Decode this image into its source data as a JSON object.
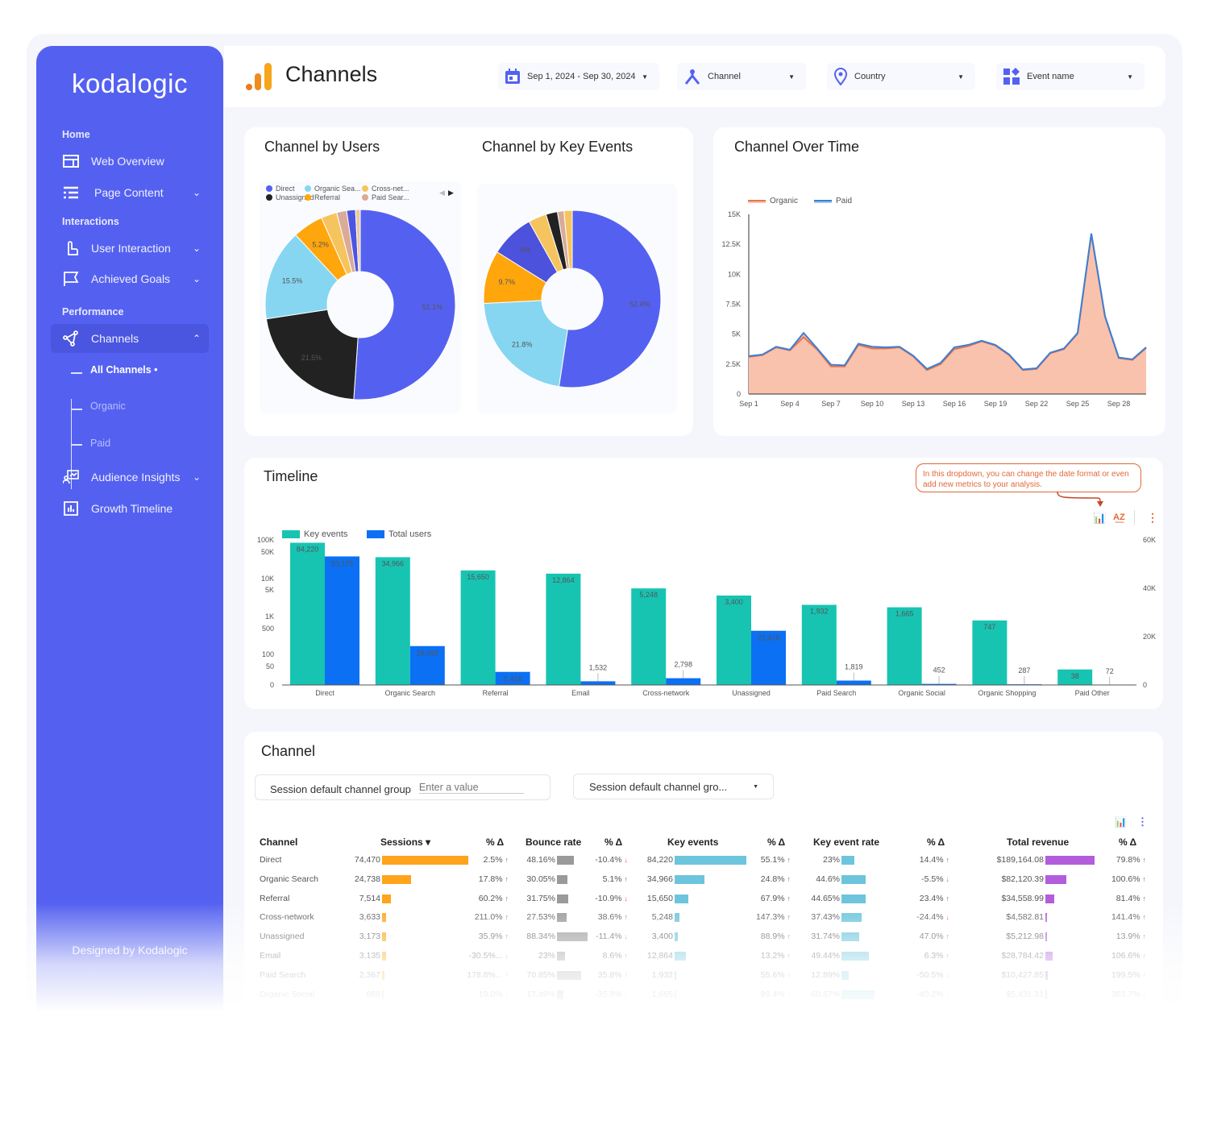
{
  "sidebar": {
    "logo": "kodalogic",
    "sections": [
      "Home",
      "Interactions",
      "Performance"
    ],
    "items": [
      {
        "label": "Web Overview",
        "icon": "layout-icon"
      },
      {
        "label": "Page Content",
        "icon": "list-icon"
      },
      {
        "label": "User Interaction",
        "icon": "hand-pointer-icon"
      },
      {
        "label": "Achieved Goals",
        "icon": "flag-icon"
      },
      {
        "label": "Channels",
        "icon": "share-nodes-icon",
        "active": true
      },
      {
        "label": "Audience Insights",
        "icon": "presentation-icon"
      },
      {
        "label": "Growth Timeline",
        "icon": "bar-chart-icon"
      }
    ],
    "subitems": [
      {
        "label": "All Channels •",
        "active": true
      },
      {
        "label": "Organic"
      },
      {
        "label": "Paid"
      }
    ],
    "footer": "Designed by Kodalogic",
    "color": "#5461f0"
  },
  "header": {
    "title": "Channels",
    "filters": {
      "date": "Sep 1, 2024 - Sep 30, 2024",
      "channel": "Channel",
      "country": "Country",
      "event": "Event name"
    }
  },
  "pies": {
    "users_title": "Channel by Users",
    "key_events_title": "Channel by Key Events",
    "legend": [
      {
        "name": "Direct",
        "color": "#5461f0"
      },
      {
        "name": "Unassigned",
        "color": "#222222"
      },
      {
        "name": "Organic Sea...",
        "color": "#86d6f2"
      },
      {
        "name": "Referral",
        "color": "#ffa60d"
      },
      {
        "name": "Cross-net...",
        "color": "#f6c45e"
      },
      {
        "name": "Paid Sear...",
        "color": "#d9ab98"
      }
    ]
  },
  "line": {
    "title": "Channel Over Time",
    "legend": [
      "Organic",
      "Paid"
    ]
  },
  "timeline": {
    "title": "Timeline",
    "tooltip": "In this dropdown, you can change the date format or even add new metrics to your analysis.",
    "legend": [
      "Key events",
      "Total users"
    ]
  },
  "channel_table": {
    "title": "Channel",
    "filter_label": "Session default channel group",
    "filter_placeholder": "Enter a value",
    "dropdown_value": "Session default channel gro...",
    "headers": [
      "Channel",
      "Sessions ▾",
      "% Δ",
      "Bounce rate",
      "% Δ",
      "Key events",
      "% Δ",
      "Key event rate",
      "% Δ",
      "Total revenue",
      "% Δ"
    ],
    "rows": [
      [
        "Direct",
        "74,470",
        "2.5%",
        "up",
        "48.16%",
        "-10.4%",
        "down",
        "84,220",
        "55.1%",
        "up",
        "23%",
        "14.4%",
        "up",
        "$189,164.08",
        "79.8%",
        "up"
      ],
      [
        "Organic Search",
        "24,738",
        "17.8%",
        "up",
        "30.05%",
        "5.1%",
        "up",
        "34,966",
        "24.8%",
        "up",
        "44.6%",
        "-5.5%",
        "down",
        "$82,120.39",
        "100.6%",
        "up"
      ],
      [
        "Referral",
        "7,514",
        "60.2%",
        "up",
        "31.75%",
        "-10.9%",
        "down",
        "15,650",
        "67.9%",
        "up",
        "44.65%",
        "23.4%",
        "up",
        "$34,558.99",
        "81.4%",
        "up"
      ],
      [
        "Cross-network",
        "3,633",
        "211.0%",
        "up",
        "27.53%",
        "38.6%",
        "up",
        "5,248",
        "147.3%",
        "up",
        "37.43%",
        "-24.4%",
        "down",
        "$4,582.81",
        "141.4%",
        "up"
      ],
      [
        "Unassigned",
        "3,173",
        "35.9%",
        "up",
        "88.34%",
        "-11.4%",
        "down",
        "3,400",
        "88.9%",
        "up",
        "31.74%",
        "47.0%",
        "up",
        "$5,212.98",
        "13.9%",
        "up"
      ],
      [
        "Email",
        "3,135",
        "-30.5%...",
        "down",
        "23%",
        "8.6%",
        "up",
        "12,864",
        "13.2%",
        "up",
        "49.44%",
        "6.3%",
        "up",
        "$28,784.42",
        "106.6%",
        "up"
      ],
      [
        "Paid Search",
        "2,367",
        "178.8%...",
        "up",
        "70.85%",
        "35.8%",
        "up",
        "1,932",
        "55.6%",
        "up",
        "12.89%",
        "-50.5%",
        "down",
        "$10,427.85",
        "199.5%",
        "up"
      ],
      [
        "Organic Social",
        "689",
        "19.0%",
        "up",
        "17.49%",
        "-35.8%",
        "down",
        "1,665",
        "89.4%",
        "up",
        "60.67%",
        "-40.2%",
        "down",
        "$5,431.31",
        "363.7%",
        "up"
      ]
    ],
    "bar_colors": {
      "sessions": "#ffa41b",
      "bounce": "#9a9a9a",
      "key_events": "#6cc5dc",
      "key_event_rate": "#6cc5dc",
      "revenue": "#b25ddc"
    }
  },
  "chart_data": [
    {
      "type": "pie",
      "title": "Channel by Users",
      "donut": true,
      "slices": [
        {
          "name": "Direct",
          "value": 51.1,
          "label": "51.1%",
          "color": "#5461f0"
        },
        {
          "name": "Unassigned",
          "value": 21.5,
          "label": "21.5%",
          "color": "#222222"
        },
        {
          "name": "Organic Search",
          "value": 15.5,
          "label": "15.5%",
          "color": "#86d6f2"
        },
        {
          "name": "Referral",
          "value": 5.2,
          "label": "5.2%",
          "color": "#ffa60d"
        },
        {
          "name": "Cross-network",
          "value": 2.7,
          "label": "",
          "color": "#f6c45e"
        },
        {
          "name": "Paid Search",
          "value": 1.7,
          "label": "",
          "color": "#d9ab98"
        },
        {
          "name": "",
          "value": 1.5,
          "label": "",
          "color": "#4c55e0"
        },
        {
          "name": "",
          "value": 0.8,
          "label": "",
          "color": "#e8c9a0"
        }
      ]
    },
    {
      "type": "pie",
      "title": "Channel by Key Events",
      "donut": true,
      "slices": [
        {
          "name": "Direct",
          "value": 52.4,
          "label": "52.4%",
          "color": "#5461f0"
        },
        {
          "name": "Organic Search",
          "value": 21.8,
          "label": "21.8%",
          "color": "#86d6f2"
        },
        {
          "name": "Referral",
          "value": 9.7,
          "label": "9.7%",
          "color": "#ffa60d"
        },
        {
          "name": "",
          "value": 8.0,
          "label": "8%",
          "color": "#4c52dc"
        },
        {
          "name": "Cross-network",
          "value": 3.3,
          "label": "",
          "color": "#f6c45e"
        },
        {
          "name": "Unassigned",
          "value": 2.1,
          "label": "",
          "color": "#222222"
        },
        {
          "name": "Paid Search",
          "value": 1.2,
          "label": "",
          "color": "#d9ab98"
        },
        {
          "name": "",
          "value": 1.5,
          "label": "",
          "color": "#f6c45e"
        }
      ]
    },
    {
      "type": "area",
      "title": "Channel Over Time",
      "stacked": true,
      "x": [
        "Sep 1",
        "Sep 2",
        "Sep 3",
        "Sep 4",
        "Sep 5",
        "Sep 6",
        "Sep 7",
        "Sep 8",
        "Sep 9",
        "Sep 10",
        "Sep 11",
        "Sep 12",
        "Sep 13",
        "Sep 14",
        "Sep 15",
        "Sep 16",
        "Sep 17",
        "Sep 18",
        "Sep 19",
        "Sep 20",
        "Sep 21",
        "Sep 22",
        "Sep 23",
        "Sep 24",
        "Sep 25",
        "Sep 26",
        "Sep 27",
        "Sep 28",
        "Sep 29",
        "Sep 30"
      ],
      "xticks": [
        "Sep 1",
        "Sep 4",
        "Sep 7",
        "Sep 10",
        "Sep 13",
        "Sep 16",
        "Sep 19",
        "Sep 22",
        "Sep 25",
        "Sep 28"
      ],
      "yticks": [
        "0",
        "2.5K",
        "5K",
        "7.5K",
        "10K",
        "12.5K",
        "15K"
      ],
      "ylim": [
        0,
        15000
      ],
      "series": [
        {
          "name": "Organic",
          "color": "#e8744f",
          "fill": "#f9c2ad",
          "values": [
            3100,
            3250,
            3900,
            3650,
            4750,
            3700,
            2300,
            2300,
            4100,
            3800,
            3800,
            3900,
            3150,
            2000,
            2500,
            3750,
            4000,
            4400,
            4050,
            3250,
            2000,
            2100,
            3400,
            3750,
            5050,
            13350,
            6450,
            3000,
            2850,
            3850
          ]
        },
        {
          "name": "Paid",
          "color": "#3b7fd4",
          "values": [
            70,
            50,
            50,
            50,
            350,
            100,
            150,
            100,
            100,
            150,
            100,
            50,
            50,
            100,
            100,
            150,
            100,
            50,
            50,
            50,
            50,
            50,
            50,
            50,
            50,
            50,
            50,
            50,
            50,
            50
          ]
        }
      ]
    },
    {
      "type": "bar",
      "title": "Timeline",
      "categories": [
        "Direct",
        "Organic Search",
        "Referral",
        "Email",
        "Cross-network",
        "Unassigned",
        "Paid Search",
        "Organic Social",
        "Organic Shopping",
        "Paid Other"
      ],
      "series": [
        {
          "name": "Key events",
          "axis": "left-log",
          "color": "#17c4b2",
          "values": [
            84220,
            34966,
            15650,
            12864,
            5248,
            3400,
            1932,
            1665,
            747,
            38
          ]
        },
        {
          "name": "Total users",
          "axis": "right",
          "color": "#0b70f4",
          "values": [
            53175,
            16092,
            5418,
            1532,
            2798,
            22418,
            1819,
            452,
            287,
            72
          ]
        }
      ],
      "yticks_left": [
        "100K",
        "50K",
        "10K",
        "5K",
        "1K",
        "500",
        "100",
        "50",
        "0"
      ],
      "yticks_right": [
        "60K",
        "40K",
        "20K",
        "0"
      ],
      "ylim_right": [
        0,
        60000
      ],
      "legend": "top-left"
    }
  ]
}
